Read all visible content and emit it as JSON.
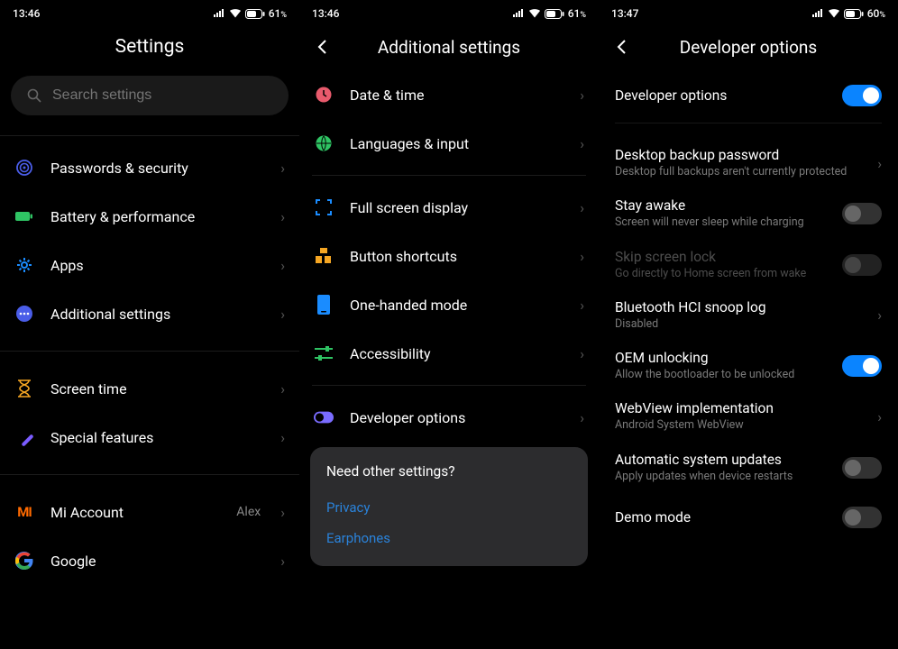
{
  "panel1": {
    "time": "13:46",
    "battery": "61",
    "title": "Settings",
    "search_placeholder": "Search settings",
    "items": [
      {
        "label": "Passwords & security"
      },
      {
        "label": "Battery & performance"
      },
      {
        "label": "Apps"
      },
      {
        "label": "Additional settings"
      }
    ],
    "items2": [
      {
        "label": "Screen time"
      },
      {
        "label": "Special features"
      }
    ],
    "items3": [
      {
        "label": "Mi Account",
        "value": "Alex"
      },
      {
        "label": "Google"
      }
    ]
  },
  "panel2": {
    "time": "13:46",
    "battery": "61",
    "title": "Additional settings",
    "groupA": [
      {
        "label": "Date & time"
      },
      {
        "label": "Languages & input"
      }
    ],
    "groupB": [
      {
        "label": "Full screen display"
      },
      {
        "label": "Button shortcuts"
      },
      {
        "label": "One-handed mode"
      },
      {
        "label": "Accessibility"
      }
    ],
    "groupC": [
      {
        "label": "Developer options"
      }
    ],
    "card": {
      "title": "Need other settings?",
      "links": [
        "Privacy",
        "Earphones"
      ]
    }
  },
  "panel3": {
    "time": "13:47",
    "battery": "60",
    "title": "Developer options",
    "master": {
      "label": "Developer options",
      "on": true
    },
    "items": [
      {
        "title": "Desktop backup password",
        "sub": "Desktop full backups aren't currently protected",
        "type": "chev"
      },
      {
        "title": "Stay awake",
        "sub": "Screen will never sleep while charging",
        "type": "toggle",
        "on": false
      },
      {
        "title": "Skip screen lock",
        "sub": "Go directly to Home screen from wake",
        "type": "toggle",
        "on": false,
        "disabled": true
      },
      {
        "title": "Bluetooth HCI snoop log",
        "sub": "Disabled",
        "type": "chev"
      },
      {
        "title": "OEM unlocking",
        "sub": "Allow the bootloader to be unlocked",
        "type": "toggle",
        "on": true
      },
      {
        "title": "WebView implementation",
        "sub": "Android System WebView",
        "type": "chev"
      },
      {
        "title": "Automatic system updates",
        "sub": "Apply updates when device restarts",
        "type": "toggle",
        "on": false
      },
      {
        "title": "Demo mode",
        "type": "toggle",
        "on": false
      }
    ]
  }
}
